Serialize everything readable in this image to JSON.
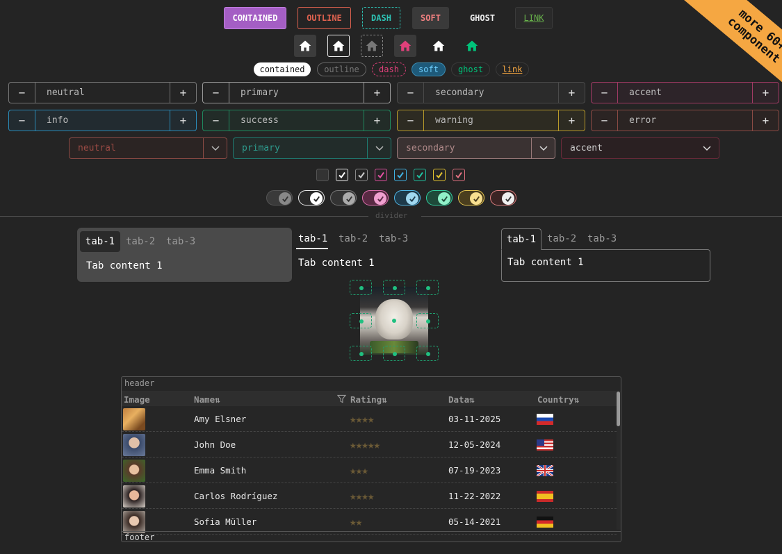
{
  "buttons": {
    "contained": "CONTAINED",
    "outline": "OUTLINE",
    "dash": "DASH",
    "soft": "SOFT",
    "ghost": "GHOST",
    "link": "LINK"
  },
  "icon_buttons": [
    "home-icon",
    "home-icon",
    "home-icon",
    "home-icon",
    "home-icon",
    "home-icon"
  ],
  "chips": {
    "contained": "contained",
    "outline": "outline",
    "dash": "dash",
    "soft": "soft",
    "ghost": "ghost",
    "link": "link"
  },
  "steppers": {
    "minus": "−",
    "plus": "+",
    "neutral": "neutral",
    "primary": "primary",
    "secondary": "secondary",
    "accent": "accent",
    "info": "info",
    "success": "success",
    "warning": "warning",
    "error": "error"
  },
  "selects": {
    "neutral": "neutral",
    "primary": "primary",
    "secondary": "secondary",
    "accent": "accent"
  },
  "divider": "divider",
  "ribbon": "more 60+\ncomponent",
  "tabs": {
    "t1": "tab-1",
    "t2": "tab-2",
    "t3": "tab-3",
    "content": "Tab content 1"
  },
  "table": {
    "header": "header",
    "footer": "footer",
    "columns": {
      "image": "Image",
      "name": "Name⇅",
      "rating": "Rating⇅",
      "data": "Data⇅",
      "country": "Country⇅"
    },
    "rows": [
      {
        "name": "Amy Elsner",
        "rating": "★★★★",
        "date": "03-11-2025",
        "country": "RU"
      },
      {
        "name": "John Doe",
        "rating": "★★★★★",
        "date": "12-05-2024",
        "country": "US"
      },
      {
        "name": "Emma Smith",
        "rating": "★★★",
        "date": "07-19-2023",
        "country": "GB"
      },
      {
        "name": "Carlos Rodríguez",
        "rating": "★★★★",
        "date": "11-22-2022",
        "country": "ES"
      },
      {
        "name": "Sofia Müller",
        "rating": "★★",
        "date": "05-14-2021",
        "country": "DE"
      }
    ]
  },
  "colors": {
    "background": "#242424",
    "contained": "#a45ec4",
    "outline": "#e0624f",
    "dash": "#2ec4b6",
    "accent_pink": "#e0407a",
    "ribbon": "#f5a742",
    "success": "#00c37a"
  }
}
